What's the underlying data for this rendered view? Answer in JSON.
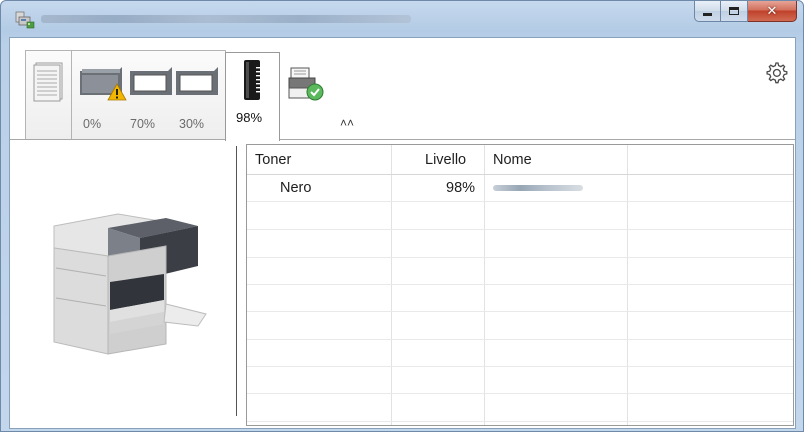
{
  "window": {
    "title_icon": "printer-network-icon",
    "controls": {
      "minimize": "minimize-icon",
      "maximize": "maximize-icon",
      "close": "✕"
    }
  },
  "toolbar": {
    "tabs": [
      {
        "id": "pages",
        "icon": "pages-stack-icon"
      },
      {
        "id": "paper",
        "icon": "paper-tray-icon",
        "levels": [
          "0%",
          "70%",
          "30%"
        ],
        "warning_icon": "warning-triangle-icon"
      },
      {
        "id": "toner",
        "icon": "toner-cartridge-icon",
        "level": "98%"
      },
      {
        "id": "status",
        "icon": "printer-status-ok-icon"
      }
    ],
    "collapse_icon": "chevron-up-icon",
    "settings_icon": "gear-icon"
  },
  "table": {
    "headers": [
      "Toner",
      "Livello",
      "Nome"
    ],
    "rows": [
      {
        "toner": "Nero",
        "livello": "98%"
      }
    ]
  },
  "colors": {
    "accent": "#c0412b",
    "frame": "#b9d0e8",
    "warning": "#f2b600",
    "ok": "#5cb85c"
  }
}
